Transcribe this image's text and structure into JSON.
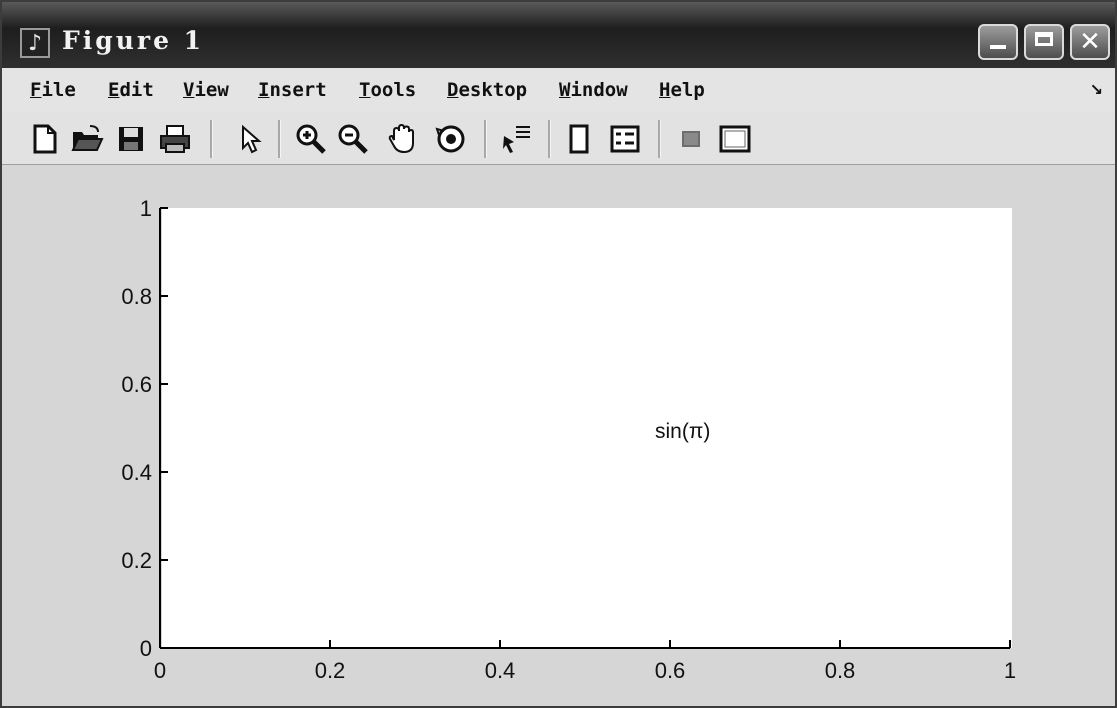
{
  "window": {
    "title": "Figure 1",
    "controls": {
      "minimize": "minimize",
      "maximize": "maximize",
      "close": "✕"
    }
  },
  "menu": {
    "items": [
      {
        "ul": "F",
        "rest": "ile"
      },
      {
        "ul": "E",
        "rest": "dit"
      },
      {
        "ul": "V",
        "rest": "iew"
      },
      {
        "ul": "I",
        "rest": "nsert"
      },
      {
        "ul": "T",
        "rest": "ools"
      },
      {
        "ul": "D",
        "rest": "esktop"
      },
      {
        "ul": "W",
        "rest": "indow"
      },
      {
        "ul": "H",
        "rest": "elp"
      }
    ],
    "more_glyph": "↘"
  },
  "toolbar": {
    "icons": [
      "new-file-icon",
      "open-folder-icon",
      "save-icon",
      "print-icon",
      "pointer-icon",
      "zoom-in-icon",
      "zoom-out-icon",
      "pan-hand-icon",
      "rotate-3d-icon",
      "data-cursor-icon",
      "colorbar-icon",
      "legend-icon",
      "hide-plot-tools-icon",
      "show-plot-tools-icon"
    ]
  },
  "chart_data": {
    "type": "scatter",
    "x_ticks": [
      "0",
      "0.2",
      "0.4",
      "0.6",
      "0.8",
      "1"
    ],
    "y_ticks": [
      "0",
      "0.2",
      "0.4",
      "0.6",
      "0.8",
      "1"
    ],
    "xlim": [
      0,
      1
    ],
    "ylim": [
      0,
      1
    ],
    "annotations": [
      {
        "text": "sin(π)",
        "x": 0.5,
        "y": 0.5
      }
    ],
    "grid": false
  }
}
